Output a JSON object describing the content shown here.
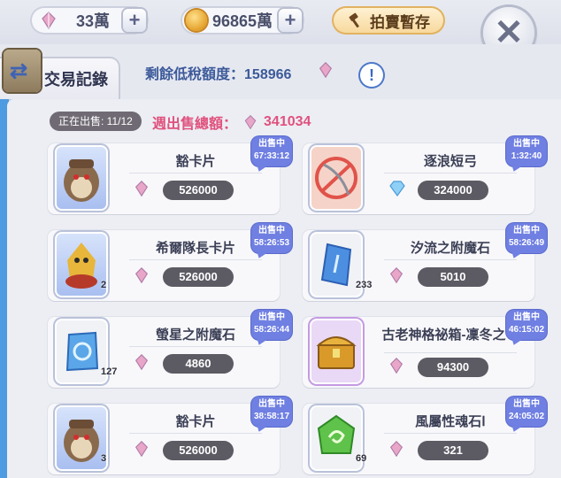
{
  "currency": {
    "gems": "33萬",
    "coins": "96865萬",
    "auction_label": "拍賣暫存"
  },
  "header": {
    "tab_label": "交易記錄",
    "tax_label": "剩餘低稅額度：",
    "tax_value": "158966",
    "info_symbol": "!"
  },
  "summary": {
    "selling_count": "正在出售: 11/12",
    "week_total_label": "週出售總額：",
    "week_total_value": "341034"
  },
  "items": [
    {
      "name": "豁卡片",
      "price": "526000",
      "status": "出售中",
      "time": "67:33:12",
      "qty": ""
    },
    {
      "name": "逐浪短弓",
      "price": "324000",
      "status": "出售中",
      "time": "1:32:40",
      "qty": ""
    },
    {
      "name": "希爾隊長卡片",
      "price": "526000",
      "status": "出售中",
      "time": "58:26:53",
      "qty": "2"
    },
    {
      "name": "汐流之附魔石",
      "price": "5010",
      "status": "出售中",
      "time": "58:26:49",
      "qty": "233"
    },
    {
      "name": "螢星之附魔石",
      "price": "4860",
      "status": "出售中",
      "time": "58:26:44",
      "qty": "127"
    },
    {
      "name": "古老神格祕箱-凜冬之弓",
      "price": "94300",
      "status": "出售中",
      "time": "46:15:02",
      "qty": ""
    },
    {
      "name": "豁卡片",
      "price": "526000",
      "status": "出售中",
      "time": "38:58:17",
      "qty": "3"
    },
    {
      "name": "風屬性魂石Ⅰ",
      "price": "321",
      "status": "出售中",
      "time": "24:05:02",
      "qty": "69"
    }
  ],
  "colors": {
    "accent_blue": "#6f7fe2",
    "price_pill": "#5c5a63",
    "week_total": "#e0517d"
  }
}
